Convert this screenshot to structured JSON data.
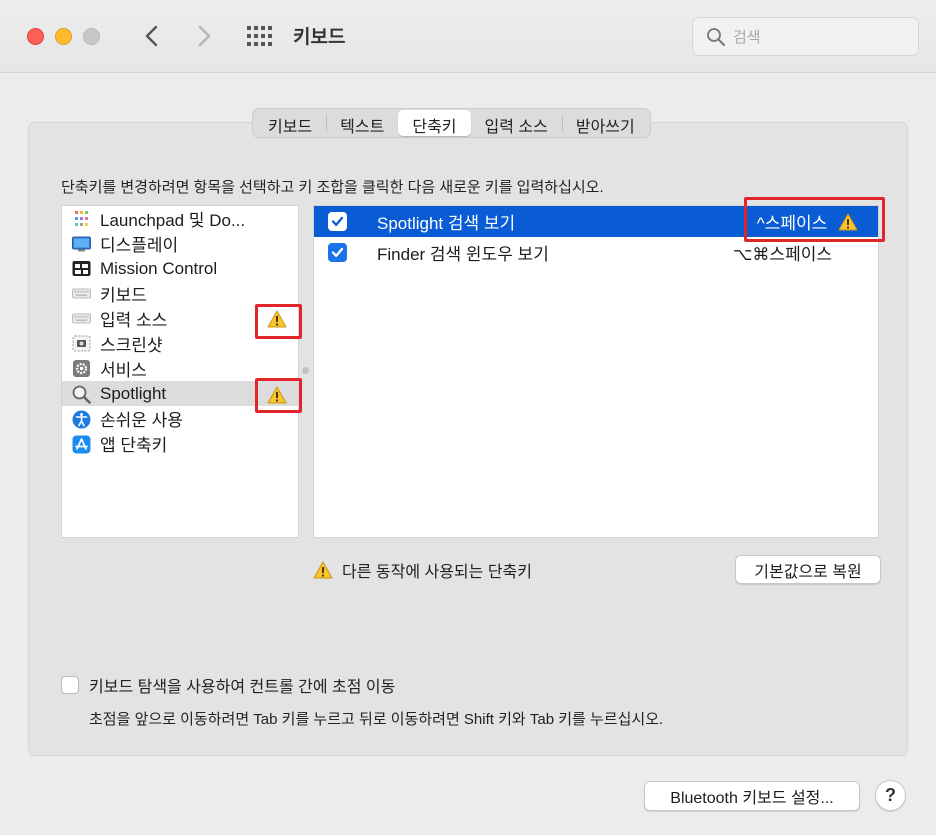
{
  "window": {
    "title": "키보드",
    "search_placeholder": "검색"
  },
  "tabs": [
    {
      "label": "키보드",
      "active": false
    },
    {
      "label": "텍스트",
      "active": false
    },
    {
      "label": "단축키",
      "active": true
    },
    {
      "label": "입력 소스",
      "active": false
    },
    {
      "label": "받아쓰기",
      "active": false
    }
  ],
  "instruction": "단축키를 변경하려면 항목을 선택하고 키 조합을 클릭한 다음 새로운 키를 입력하십시오.",
  "categories": [
    {
      "label": "Launchpad 및 Do...",
      "icon": "launchpad-icon",
      "warning": false,
      "selected": false
    },
    {
      "label": "디스플레이",
      "icon": "display-icon",
      "warning": false,
      "selected": false
    },
    {
      "label": "Mission Control",
      "icon": "mission-control-icon",
      "warning": false,
      "selected": false
    },
    {
      "label": "키보드",
      "icon": "keyboard-icon",
      "warning": false,
      "selected": false
    },
    {
      "label": "입력 소스",
      "icon": "keyboard-icon",
      "warning": true,
      "selected": false
    },
    {
      "label": "스크린샷",
      "icon": "screenshot-icon",
      "warning": false,
      "selected": false
    },
    {
      "label": "서비스",
      "icon": "gear-icon",
      "warning": false,
      "selected": false
    },
    {
      "label": "Spotlight",
      "icon": "magnifier-icon",
      "warning": true,
      "selected": true
    },
    {
      "label": "손쉬운 사용",
      "icon": "accessibility-icon",
      "warning": false,
      "selected": false
    },
    {
      "label": "앱 단축키",
      "icon": "app-store-icon",
      "warning": false,
      "selected": false
    }
  ],
  "shortcuts": [
    {
      "label": "Spotlight 검색 보기",
      "key": "^스페이스",
      "checked": true,
      "selected": true,
      "warning": true
    },
    {
      "label": "Finder 검색 윈도우 보기",
      "key": "⌥⌘스페이스",
      "checked": true,
      "selected": false,
      "warning": false
    }
  ],
  "legend": "다른 동작에 사용되는 단축키",
  "restore_button": "기본값으로 복원",
  "keyboard_nav": {
    "label": "키보드 탐색을 사용하여 컨트롤 간에 초점 이동",
    "checked": false,
    "hint": "초점을 앞으로 이동하려면 Tab 키를 누르고 뒤로 이동하려면 Shift 키와 Tab 키를 누르십시오."
  },
  "bluetooth_button": "Bluetooth 키보드 설정...",
  "help_button": "?",
  "colors": {
    "selection_blue": "#0a5cd5",
    "checkbox_blue": "#1a73e8",
    "warning_yellow": "#f7c530",
    "highlight_red": "#e0262a"
  }
}
